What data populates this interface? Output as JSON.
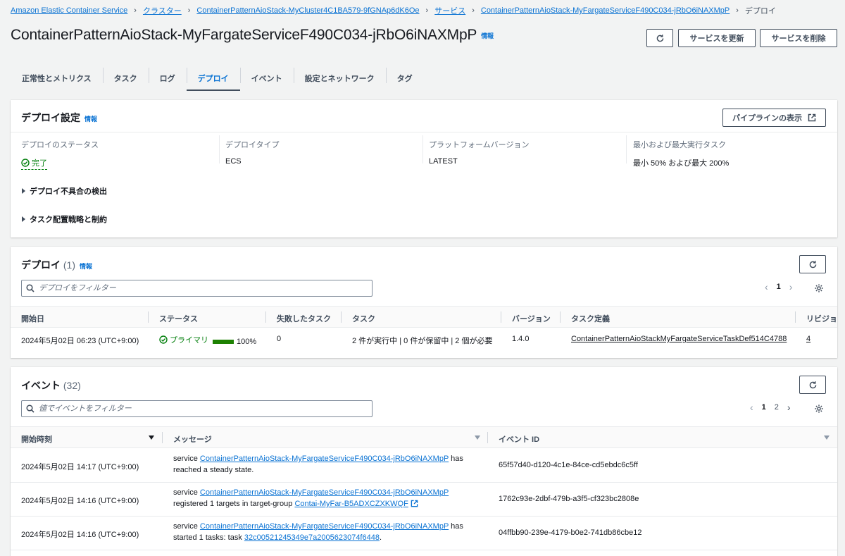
{
  "breadcrumb": {
    "items": [
      "Amazon Elastic Container Service",
      "クラスター",
      "ContainerPatternAioStack-MyCluster4C1BA579-9fGNAp6dK6Oe",
      "サービス",
      "ContainerPatternAioStack-MyFargateServiceF490C034-jRbO6iNAXMpP"
    ],
    "current": "デプロイ"
  },
  "page": {
    "title": "ContainerPatternAioStack-MyFargateServiceF490C034-jRbO6iNAXMpP",
    "info": "情報",
    "update_button": "サービスを更新",
    "delete_button": "サービスを削除"
  },
  "tabs": [
    "正常性とメトリクス",
    "タスク",
    "ログ",
    "デプロイ",
    "イベント",
    "設定とネットワーク",
    "タグ"
  ],
  "active_tab": "デプロイ",
  "deploy_settings": {
    "title": "デプロイ設定",
    "info": "情報",
    "pipeline_button": "パイプラインの表示",
    "fields": [
      {
        "label": "デプロイのステータス",
        "value": "完了"
      },
      {
        "label": "デプロイタイプ",
        "value": "ECS"
      },
      {
        "label": "プラットフォームバージョン",
        "value": "LATEST"
      },
      {
        "label": "最小および最大実行タスク",
        "value": "最小 50% および最大 200%"
      }
    ],
    "expanders": [
      "デプロイ不具合の検出",
      "タスク配置戦略と制約"
    ]
  },
  "deployments": {
    "title": "デプロイ",
    "count": "(1)",
    "info": "情報",
    "filter_placeholder": "デプロイをフィルター",
    "page": "1",
    "columns": [
      "開始日",
      "ステータス",
      "失敗したタスク",
      "タスク",
      "バージョン",
      "タスク定義",
      "リビジョ"
    ],
    "row": {
      "start": "2024年5月02日 06:23 (UTC+9:00)",
      "status": "プライマリ",
      "progress_percent": 100,
      "progress": "100%",
      "failed": "0",
      "tasks": "2 件が実行中 | 0 件が保留中 | 2 個が必要",
      "version": "1.4.0",
      "task_def": "ContainerPatternAioStackMyFargateServiceTaskDef514C4788",
      "revision": "4"
    }
  },
  "events": {
    "title": "イベント",
    "count": "(32)",
    "filter_placeholder": "値でイベントをフィルター",
    "pages": [
      "1",
      "2"
    ],
    "columns": [
      "開始時刻",
      "メッセージ",
      "イベント ID"
    ],
    "rows": [
      {
        "time": "2024年5月02日 14:17 (UTC+9:00)",
        "pre": "service ",
        "link": "ContainerPatternAioStack-MyFargateServiceF490C034-jRbO6iNAXMpP",
        "post": " has reached a steady state.",
        "id": "65f57d40-d120-4c1e-84ce-cd5ebdc6c5ff"
      },
      {
        "time": "2024年5月02日 14:16 (UTC+9:00)",
        "pre": "service ",
        "link": "ContainerPatternAioStack-MyFargateServiceF490C034-jRbO6iNAXMpP",
        "post": " registered 1 targets in target-group ",
        "link2": "Contai-MyFar-B5ADXCZXKWQF",
        "id": "1762c93e-2dbf-479b-a3f5-cf323bc2808e"
      },
      {
        "time": "2024年5月02日 14:16 (UTC+9:00)",
        "pre": "service ",
        "link": "ContainerPatternAioStack-MyFargateServiceF490C034-jRbO6iNAXMpP",
        "post": " has started 1 tasks: task ",
        "link2": "32c00521245349e7a2005623074f6448",
        "post2": ".",
        "id": "04ffbb90-239e-4179-b0e2-741db86cbe12"
      }
    ]
  },
  "colors": {
    "link": "#0972d3",
    "success": "#037f0c",
    "progress": "#1d8102",
    "page_bg": "#f2f3f3"
  },
  "icons": [
    "refresh-icon",
    "external-link-icon",
    "search-icon",
    "settings-icon",
    "success-icon",
    "caret-right-icon",
    "chevron-left-icon",
    "chevron-right-icon",
    "sort-icon"
  ]
}
